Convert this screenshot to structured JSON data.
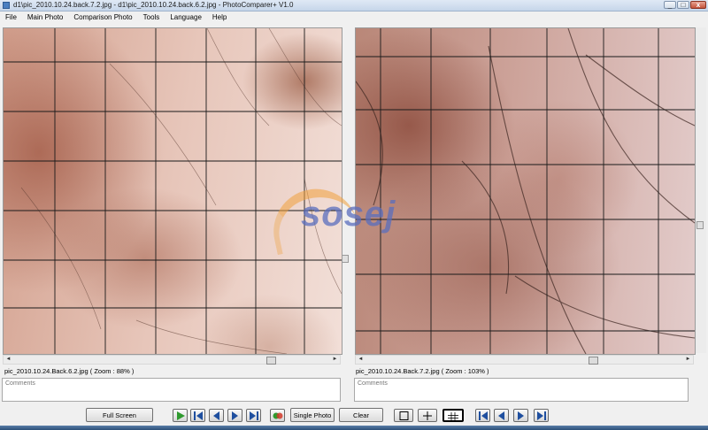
{
  "window": {
    "title": "d1\\pic_2010.10.24.back.7.2.jpg - d1\\pic_2010.10.24.back.6.2.jpg - PhotoComparer+ V1.0",
    "minimize_glyph": "_",
    "maximize_glyph": "□",
    "close_glyph": "x"
  },
  "menu": [
    "File",
    "Main Photo",
    "Comparison Photo",
    "Tools",
    "Language",
    "Help"
  ],
  "watermark": {
    "text": "sosej"
  },
  "main_photo": {
    "label": "pic_2010.10.24.Back.6.2.jpg  ( Zoom : 88% )",
    "comments_placeholder": "Comments",
    "hscroll_position": 0.82
  },
  "comparison_photo": {
    "label": "pic_2010.10.24.Back.7.2.jpg  ( Zoom : 103% )",
    "comments_placeholder": "Comments",
    "hscroll_position": 0.72
  },
  "toolbar": {
    "full_screen": "Full Screen",
    "single_photo": "Single Photo",
    "clear": "Clear",
    "selected_overlay": "grid"
  },
  "icons": {
    "play": "play-icon",
    "first": "first-icon",
    "prev": "prev-icon",
    "next": "next-icon",
    "last": "last-icon",
    "sync": "sync-icon",
    "square": "square-icon",
    "crosshair": "crosshair-icon",
    "grid": "grid-icon"
  },
  "colors": {
    "nav_blue": "#1f4f9f",
    "play_green": "#2f9a2f",
    "grid_line": "#1a1a1a"
  }
}
